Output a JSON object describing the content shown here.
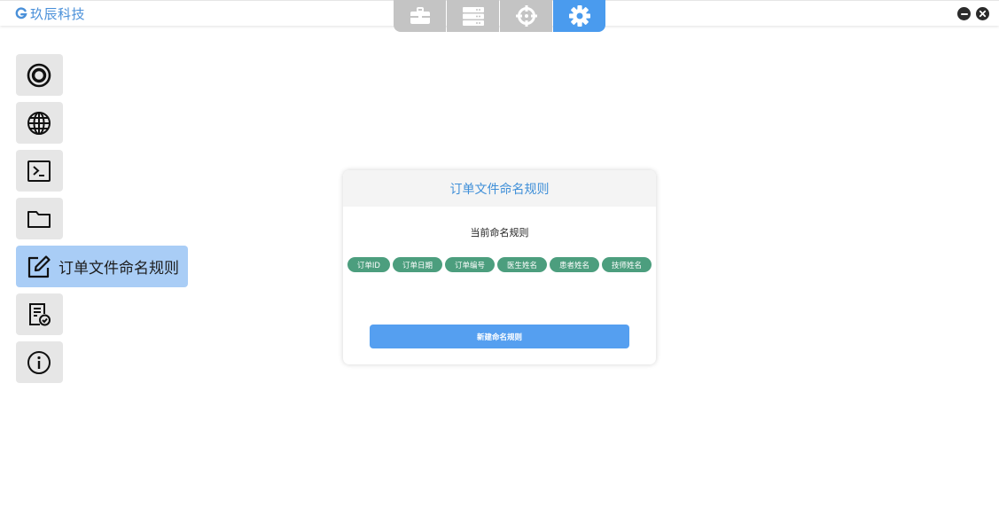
{
  "app": {
    "brand": "玖辰科技",
    "accent_color": "#4a9bee"
  },
  "top_tabs": [
    {
      "icon": "toolbox-icon",
      "active": false
    },
    {
      "icon": "server-icon",
      "active": false
    },
    {
      "icon": "crosshair-icon",
      "active": false
    },
    {
      "icon": "gear-icon",
      "active": true
    }
  ],
  "window_controls": {
    "minimize_icon": "minimize-icon",
    "close_icon": "close-icon"
  },
  "sidebar": {
    "items": [
      {
        "icon": "target-icon",
        "label": ""
      },
      {
        "icon": "globe-icon",
        "label": ""
      },
      {
        "icon": "terminal-icon",
        "label": ""
      },
      {
        "icon": "folder-icon",
        "label": ""
      },
      {
        "icon": "edit-icon",
        "label": "订单文件命名规则",
        "active": true
      },
      {
        "icon": "document-check-icon",
        "label": ""
      },
      {
        "icon": "info-icon",
        "label": ""
      }
    ]
  },
  "card": {
    "title": "订单文件命名规则",
    "subtitle": "当前命名规则",
    "tags": [
      "订单ID",
      "订单日期",
      "订单编号",
      "医生姓名",
      "患者姓名",
      "技师姓名"
    ],
    "tag_color": "#4c9e7e",
    "create_button": "新建命名规则"
  }
}
